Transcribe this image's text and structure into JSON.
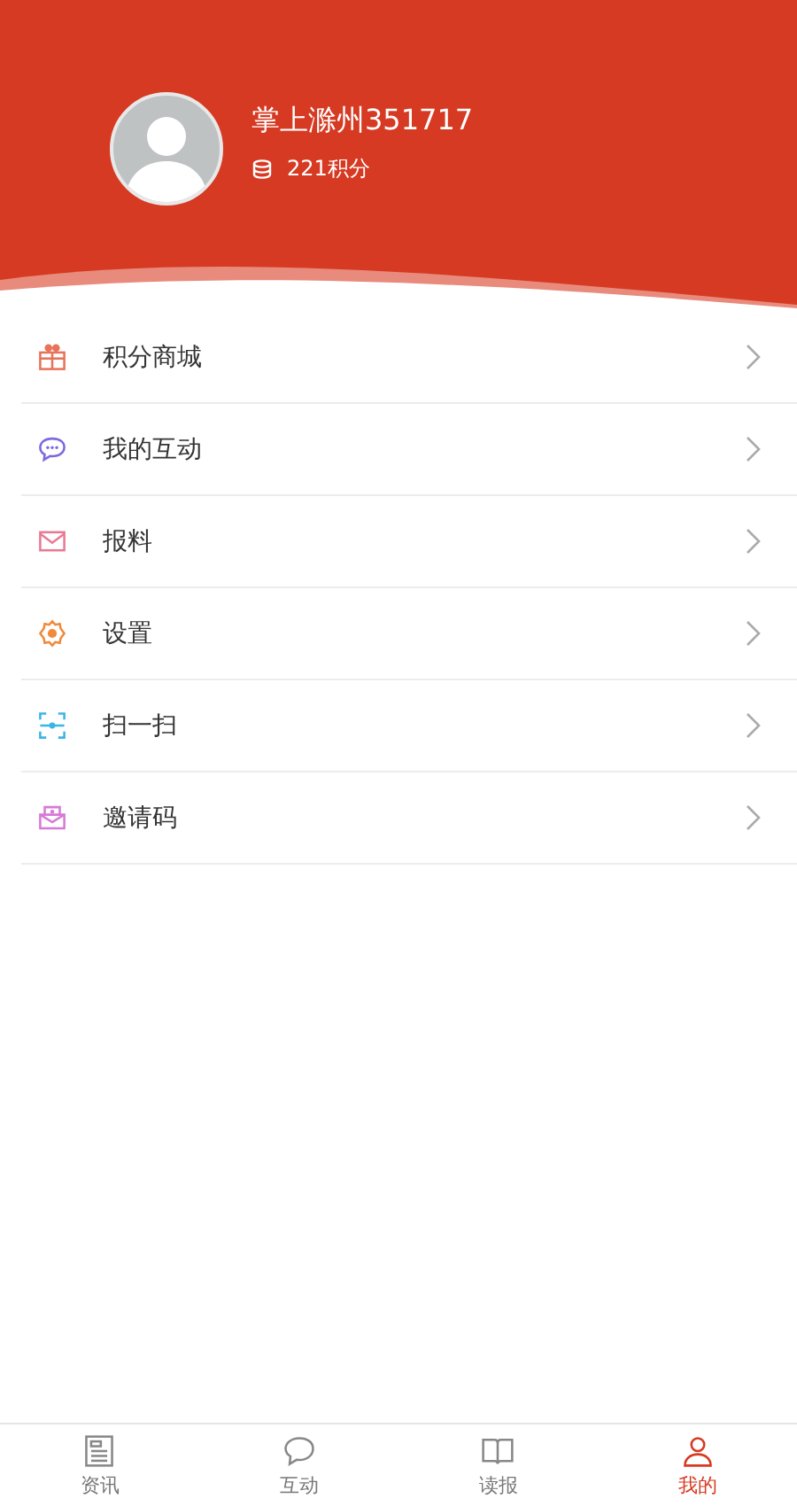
{
  "profile": {
    "name": "掌上滁州351717",
    "points": "221积分"
  },
  "menu": [
    {
      "kind": "gift",
      "label": "积分商城"
    },
    {
      "kind": "chat",
      "label": "我的互动"
    },
    {
      "kind": "mail",
      "label": "报料"
    },
    {
      "kind": "gear",
      "label": "设置"
    },
    {
      "kind": "scan",
      "label": "扫一扫"
    },
    {
      "kind": "invite",
      "label": "邀请码"
    }
  ],
  "tabs": [
    {
      "kind": "news",
      "label": "资讯",
      "selected": false
    },
    {
      "kind": "chat",
      "label": "互动",
      "selected": false
    },
    {
      "kind": "paper",
      "label": "读报",
      "selected": false
    },
    {
      "kind": "user",
      "label": "我的",
      "selected": true
    }
  ]
}
